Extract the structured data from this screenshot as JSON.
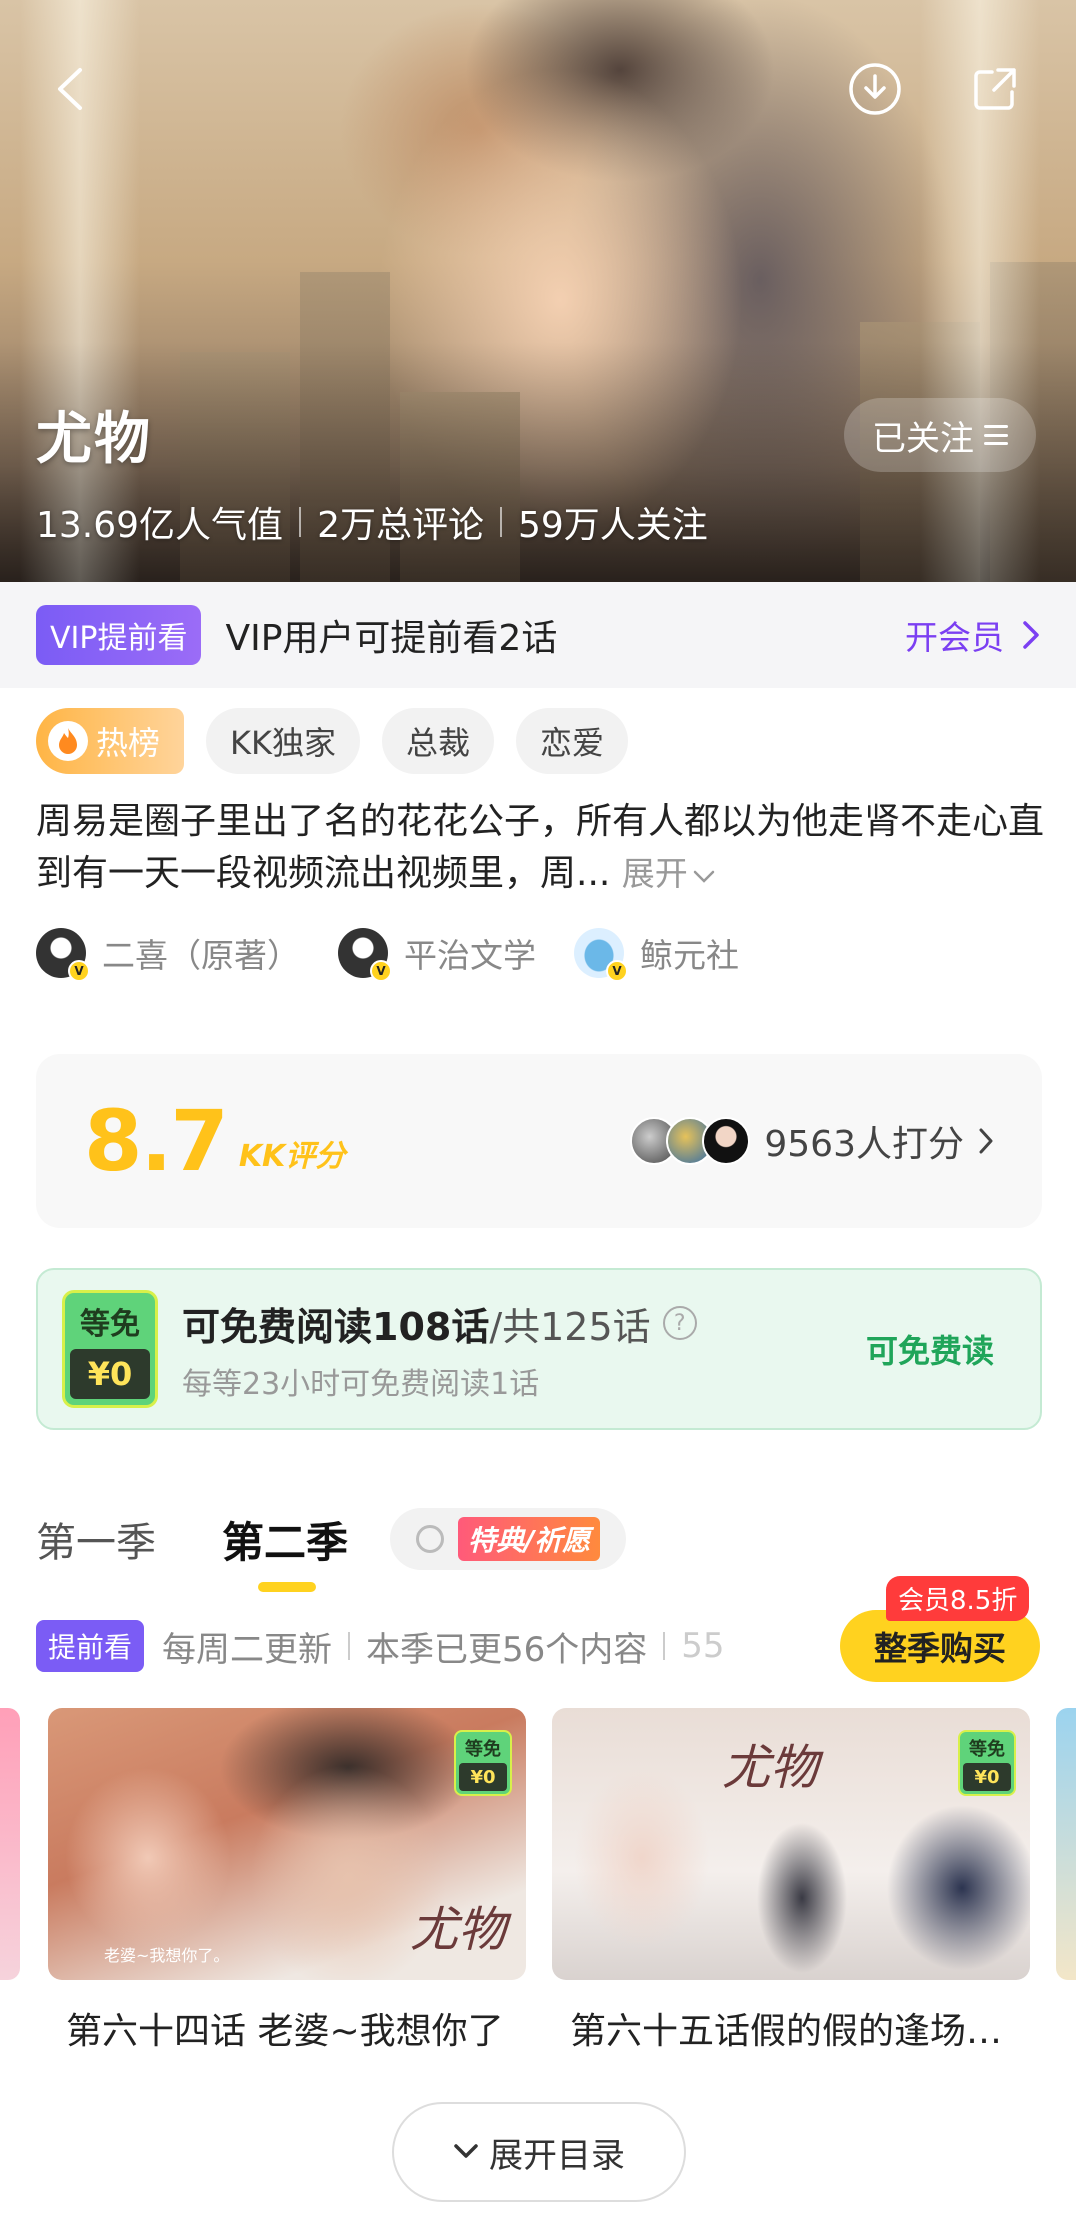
{
  "hero": {
    "title": "尤物",
    "popularity": "13.69亿人气值",
    "comments": "2万总评论",
    "followers": "59万人关注",
    "follow_label": "已关注"
  },
  "vip": {
    "badge": "VIP提前看",
    "text": "VIP用户可提前看2话",
    "link": "开会员"
  },
  "tags": {
    "hot": "热榜",
    "items": [
      "KK独家",
      "总裁",
      "恋爱"
    ]
  },
  "description": {
    "text": "周易是圈子里出了名的花花公子，所有人都以为他走肾不走心直到有一天一段视频流出视频里，周...",
    "more": "展开"
  },
  "authors": [
    "二喜（原著）",
    "平治文学",
    "鲸元社"
  ],
  "rating": {
    "score": "8.7",
    "label": "KK评分",
    "raters": "9563人打分"
  },
  "free": {
    "badge_top": "等免",
    "badge_price": "¥0",
    "readable": "可免费阅读108话",
    "total": "/共125话",
    "help_icon": "?",
    "wait_text": "每等23小时可免费阅读1话",
    "action": "可免费读"
  },
  "seasons": {
    "tabs": [
      "第一季",
      "第二季"
    ],
    "active_index": 1,
    "special": "特典/祈愿"
  },
  "update": {
    "badge": "提前看",
    "schedule": "每周二更新",
    "count": "本季已更56个内容",
    "partial": "55",
    "buy_label": "整季购买",
    "discount": "会员8.5折"
  },
  "episodes": [
    {
      "title": "第六十四话 老婆~我想你了",
      "free_top": "等免",
      "free_price": "¥0",
      "caption": "老婆~我想你了。",
      "logo": "尤物"
    },
    {
      "title": "第六十五话假的假的逢场作戏",
      "free_top": "等免",
      "free_price": "¥0",
      "logo": "尤物"
    }
  ],
  "expand_label": "展开目录",
  "colors": {
    "accent_yellow": "#ffd21f",
    "vip_purple": "#7b5cf5",
    "free_green": "#20a55a",
    "score_yellow": "#ffc21a"
  }
}
